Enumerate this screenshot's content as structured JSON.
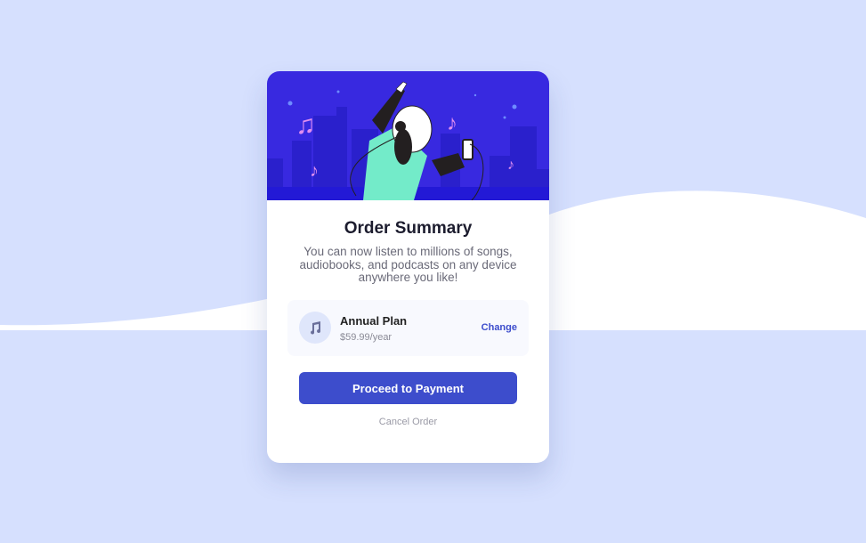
{
  "card": {
    "title": "Order Summary",
    "description": "You can now listen to millions of songs, audiobooks, and podcasts on any device anywhere you like!",
    "plan": {
      "icon": "music-note-icon",
      "name": "Annual Plan",
      "price": "$59.99/year",
      "change_label": "Change"
    },
    "primary_button": "Proceed to Payment",
    "cancel_label": "Cancel Order"
  },
  "colors": {
    "background": "#d6e0fe",
    "accent": "#3d4dcc",
    "hero": "#3829e0"
  }
}
